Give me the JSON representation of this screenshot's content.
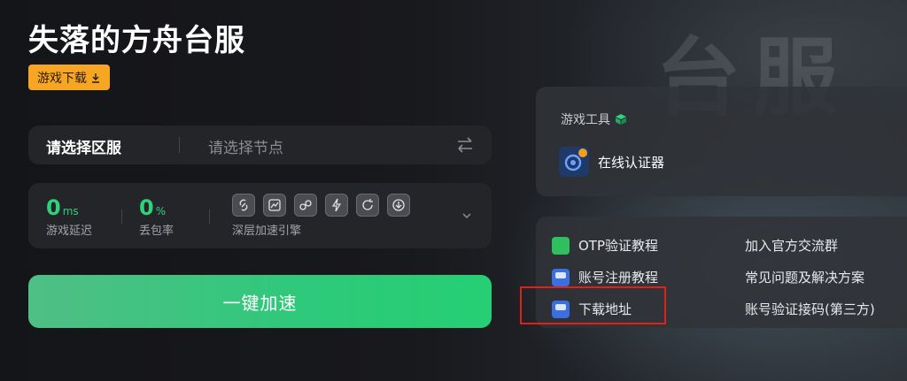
{
  "page": {
    "title": "失落的方舟台服",
    "background_glyphs": "台服"
  },
  "download_button": {
    "label": "游戏下载",
    "icon": "download-icon",
    "color": "#f6a623"
  },
  "server_select": {
    "region_label": "请选择区服",
    "node_placeholder": "请选择节点",
    "swap_icon": "swap-arrows-icon"
  },
  "stats": {
    "latency": {
      "value": "0",
      "unit": "ms",
      "label": "游戏延迟"
    },
    "packet_loss": {
      "value": "0",
      "unit": "%",
      "label": "丢包率"
    },
    "engine_label": "深层加速引擎",
    "engine_icons": [
      "link-icon",
      "chart-icon",
      "nodes-icon",
      "bolt-icon",
      "refresh-icon",
      "download-circle-icon"
    ],
    "accent": "#2fd27a"
  },
  "accelerate_button": {
    "label": "一键加速",
    "color": "#2ec97a"
  },
  "tools": {
    "title": "游戏工具",
    "items": [
      {
        "label": "在线认证器",
        "icon": "authenticator-icon"
      }
    ]
  },
  "links": {
    "left": [
      {
        "label": "OTP验证教程",
        "icon": "link-icon"
      },
      {
        "label": "账号注册教程",
        "icon": "www-icon"
      },
      {
        "label": "下载地址",
        "icon": "www-icon"
      }
    ],
    "right": [
      {
        "label": "加入官方交流群"
      },
      {
        "label": "常见问题及解决方案"
      },
      {
        "label": "账号验证接码(第三方)"
      }
    ],
    "highlight_color": "#e0201b"
  }
}
